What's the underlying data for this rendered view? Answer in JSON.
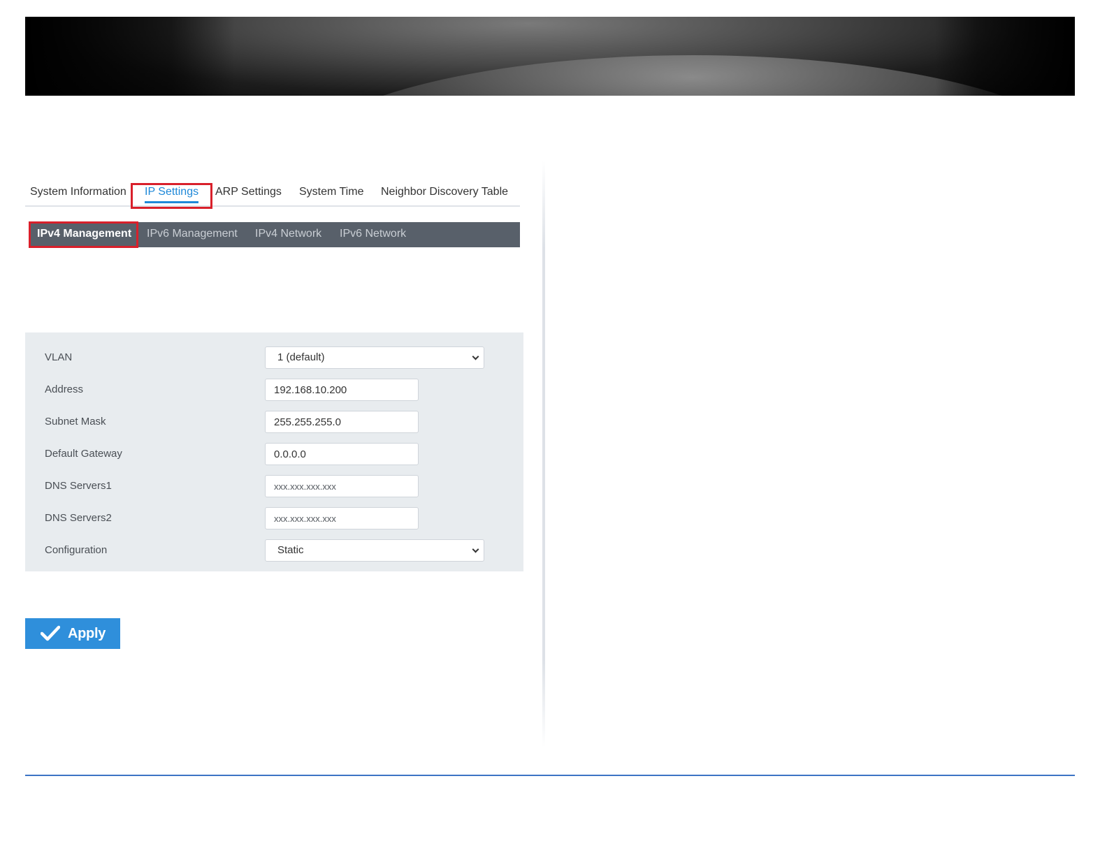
{
  "top_tabs": [
    {
      "label": "System Information",
      "active": false
    },
    {
      "label": "IP Settings",
      "active": true
    },
    {
      "label": "ARP Settings",
      "active": false
    },
    {
      "label": "System Time",
      "active": false
    },
    {
      "label": "Neighbor Discovery Table",
      "active": false
    }
  ],
  "sub_tabs": [
    {
      "label": "IPv4 Management",
      "active": true
    },
    {
      "label": "IPv6 Management",
      "active": false
    },
    {
      "label": "IPv4 Network",
      "active": false
    },
    {
      "label": "IPv6 Network",
      "active": false
    }
  ],
  "form": {
    "vlan": {
      "label": "VLAN",
      "value": "1 (default)"
    },
    "address": {
      "label": "Address",
      "value": "192.168.10.200",
      "placeholder": ""
    },
    "subnet_mask": {
      "label": "Subnet Mask",
      "value": "255.255.255.0",
      "placeholder": ""
    },
    "default_gateway": {
      "label": "Default Gateway",
      "value": "0.0.0.0",
      "placeholder": ""
    },
    "dns_servers1": {
      "label": "DNS Servers1",
      "value": "",
      "placeholder": "xxx.xxx.xxx.xxx"
    },
    "dns_servers2": {
      "label": "DNS Servers2",
      "value": "",
      "placeholder": "xxx.xxx.xxx.xxx"
    },
    "configuration": {
      "label": "Configuration",
      "value": "Static"
    }
  },
  "apply_button": {
    "label": "Apply",
    "icon": "checkmark-icon"
  },
  "colors": {
    "accent": "#1e88d8",
    "highlight": "#d9202b",
    "subtab_bar": "#58606a",
    "form_panel": "#e8ecef",
    "apply_button": "#2f8fdb",
    "bottom_rule": "#3c74c4"
  }
}
